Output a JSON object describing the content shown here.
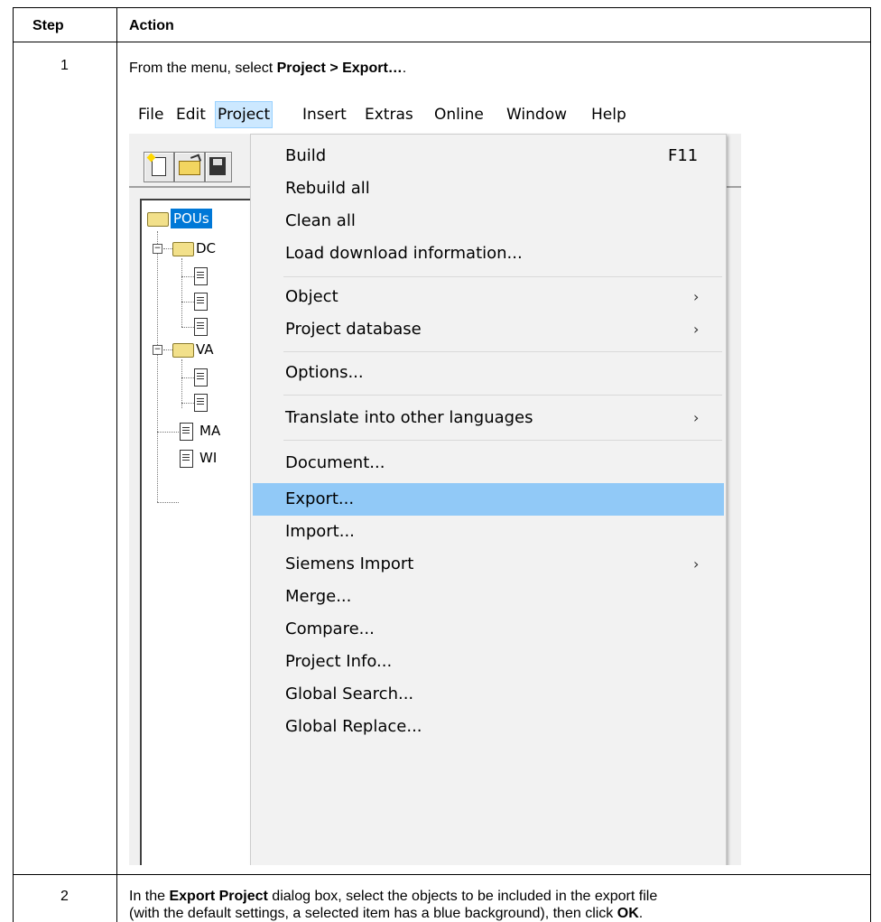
{
  "table": {
    "header_step": "Step",
    "header_action": "Action",
    "row1_step": "1",
    "row1_prefix": "From the menu, select ",
    "row1_bold": "Project > Export…",
    "row1_suffix": ".",
    "row2_step": "2",
    "row2_a": "In the ",
    "row2_bold1": "Export Project",
    "row2_b": " dialog box, select the objects to be included in the export file",
    "row2_c": "(with the default settings, a selected item has a blue background), then click ",
    "row2_bold2": "OK",
    "row2_d": "."
  },
  "screenshot": {
    "menubar": [
      "File",
      "Edit",
      "Project",
      "Insert",
      "Extras",
      "Online",
      "Window",
      "Help"
    ],
    "tree": {
      "root": "POUs",
      "folder1": "DC",
      "folder2": "VA",
      "item1": "MA",
      "item2": "WI"
    },
    "menu": {
      "build": "Build",
      "build_acc": "F11",
      "rebuild": "Rebuild all",
      "clean": "Clean all",
      "load": "Load download information...",
      "object": "Object",
      "projdb": "Project database",
      "options": "Options...",
      "translate": "Translate into other languages",
      "document": "Document...",
      "export": "Export...",
      "import": "Import...",
      "siemens": "Siemens Import",
      "merge": "Merge...",
      "compare": "Compare...",
      "info": "Project Info...",
      "gsearch": "Global Search...",
      "greplace": "Global Replace..."
    }
  }
}
